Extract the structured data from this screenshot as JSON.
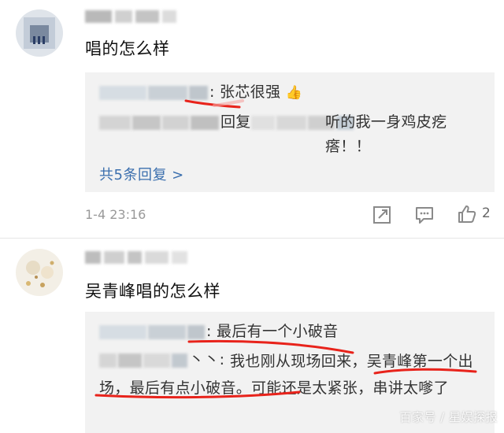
{
  "comment1": {
    "text": "唱的怎么样",
    "replies": [
      {
        "prefix": ":",
        "text": "张芯很强",
        "emoji": "👍"
      },
      {
        "prefix": "回复",
        "suffix": ":",
        "text": "听的我一身鸡皮疙瘩！！"
      }
    ],
    "more_replies": "共5条回复 >",
    "time": "1-4 23:16",
    "like_count": "2"
  },
  "comment2": {
    "text": "吴青峰唱的怎么样",
    "replies": [
      {
        "prefix": ":",
        "text": "最后有一个小破音"
      },
      {
        "prefix": "丶丶:",
        "text": "我也刚从现场回来，吴青峰第一个出场，最后有点小破音。可能还是太紧张，串讲太嗲了"
      }
    ]
  },
  "watermark": "百家号 / 星娱探报",
  "colors": {
    "link": "#3b6fae",
    "reply_bg": "#f2f2f2",
    "underline": "#e8231b",
    "meta": "#999999"
  },
  "icons": {
    "share": "share-icon",
    "comment": "comment-icon",
    "like": "thumb-up-icon"
  }
}
